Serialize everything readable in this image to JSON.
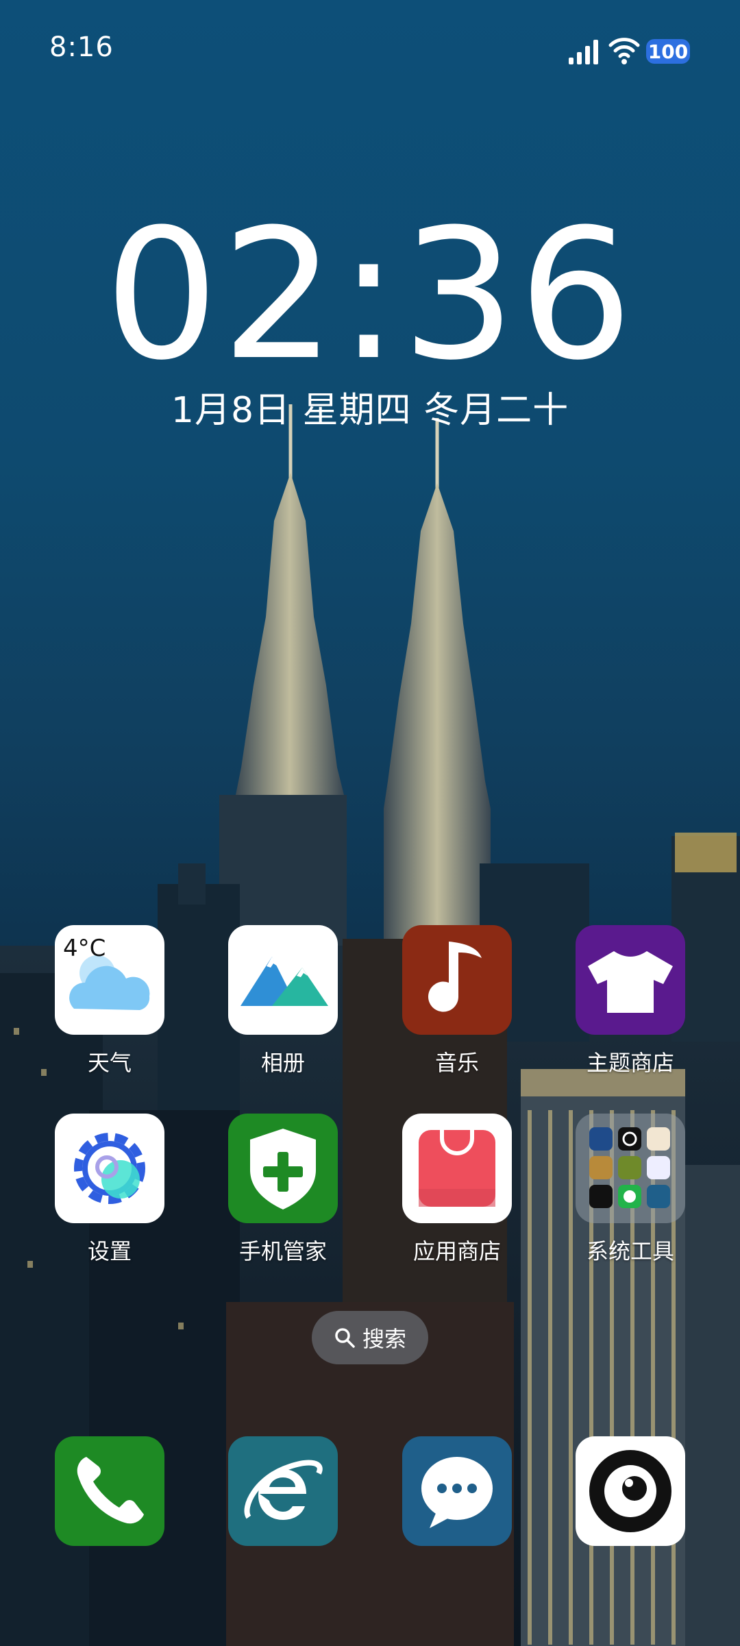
{
  "status_bar": {
    "time": "8:16",
    "battery": "100",
    "icons": [
      "signal-icon",
      "wifi-icon",
      "battery-icon"
    ]
  },
  "lock_clock": {
    "time": "02:36",
    "date": "1月8日 星期四 冬月二十"
  },
  "apps": [
    {
      "label": "天气",
      "icon": "weather-icon",
      "badge_text": "4°C"
    },
    {
      "label": "相册",
      "icon": "gallery-icon"
    },
    {
      "label": "音乐",
      "icon": "music-icon"
    },
    {
      "label": "主题商店",
      "icon": "theme-store-icon"
    },
    {
      "label": "设置",
      "icon": "settings-icon"
    },
    {
      "label": "手机管家",
      "icon": "phone-manager-icon"
    },
    {
      "label": "应用商店",
      "icon": "app-store-icon"
    },
    {
      "label": "系统工具",
      "icon": "system-tools-folder-icon"
    }
  ],
  "search": {
    "label": "搜索"
  },
  "dock": [
    {
      "icon": "phone-icon"
    },
    {
      "icon": "browser-icon"
    },
    {
      "icon": "messages-icon"
    },
    {
      "icon": "camera-icon"
    }
  ],
  "colors": {
    "sky": "#0d4f78",
    "music_tile": "#8b2a14",
    "theme_tile": "#5a1a8e",
    "phone_manager_tile": "#1e8a24",
    "phone_tile": "#1e8a24",
    "browser_tile": "#1f6f7f",
    "messages_tile": "#1f5f8a",
    "battery": "#2c6fe0"
  }
}
